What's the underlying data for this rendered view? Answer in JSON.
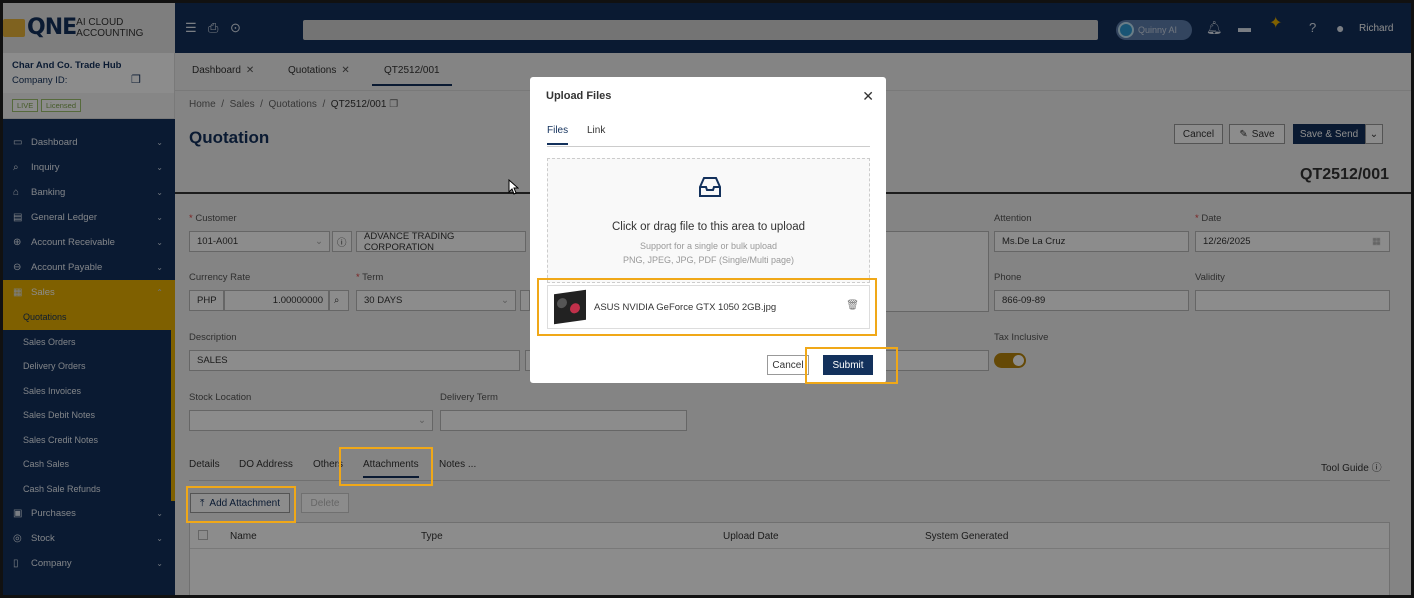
{
  "topbar": {
    "logo_text": "QNE",
    "logo_tagline": "AI CLOUD ACCOUNTING",
    "assistant_label": "Quinny AI",
    "user_name": "Richard"
  },
  "company": {
    "name": "Char And Co. Trade Hub",
    "id_label": "Company ID:",
    "live_badge": "LIVE",
    "licensed_badge": "Licensed"
  },
  "sidebar": {
    "items": [
      {
        "label": "Dashboard",
        "icon": "monitor-icon"
      },
      {
        "label": "Inquiry",
        "icon": "inquiry-icon"
      },
      {
        "label": "Banking",
        "icon": "bank-icon"
      },
      {
        "label": "General Ledger",
        "icon": "ledger-icon"
      },
      {
        "label": "Account Receivable",
        "icon": "receivable-icon"
      },
      {
        "label": "Account Payable",
        "icon": "payable-icon"
      },
      {
        "label": "Sales",
        "icon": "sales-icon"
      }
    ],
    "sales_sub": [
      "Quotations",
      "Sales Orders",
      "Delivery Orders",
      "Sales Invoices",
      "Sales Debit Notes",
      "Sales Credit Notes",
      "Cash Sales",
      "Cash Sale Refunds"
    ],
    "after": [
      {
        "label": "Purchases",
        "icon": "purchases-icon"
      },
      {
        "label": "Stock",
        "icon": "stock-icon"
      },
      {
        "label": "Company",
        "icon": "company-icon"
      }
    ]
  },
  "tabs": [
    "Dashboard",
    "Quotations",
    "QT2512/001"
  ],
  "breadcrumb": {
    "home": "Home",
    "sales": "Sales",
    "quotations": "Quotations",
    "current": "QT2512/001"
  },
  "page": {
    "title": "Quotation",
    "doc_number": "QT2512/001",
    "cancel": "Cancel",
    "save": "Save",
    "save_send": "Save & Send"
  },
  "form": {
    "customer_label": "Customer",
    "customer_code": "101-A001",
    "customer_name": "ADVANCE TRADING CORPORATION",
    "attention_label": "Attention",
    "attention_value": "Ms.De La Cruz",
    "date_label": "Date",
    "date_value": "12/26/2025",
    "currency_label": "Currency Rate",
    "currency_code": "PHP",
    "currency_rate": "1.00000000",
    "term_label": "Term",
    "term_value": "30 DAYS",
    "phone_label": "Phone",
    "phone_value": "866-09-89",
    "validity_label": "Validity",
    "description_label": "Description",
    "description_value": "SALES",
    "tax_label": "Tax Inclusive",
    "stock_location_label": "Stock Location",
    "delivery_term_label": "Delivery Term"
  },
  "subtabs": {
    "details": "Details",
    "do_address": "DO Address",
    "others": "Others",
    "attachments": "Attachments",
    "notes": "Notes ...",
    "tool_guide": "Tool Guide"
  },
  "attachments": {
    "add": "Add Attachment",
    "delete": "Delete",
    "columns": [
      "Name",
      "Type",
      "Upload Date",
      "System Generated"
    ]
  },
  "modal": {
    "title": "Upload Files",
    "tab_files": "Files",
    "tab_link": "Link",
    "drop_title": "Click or drag file to this area to upload",
    "drop_hint1": "Support for a single or bulk upload",
    "drop_hint2": "PNG, JPEG, JPG, PDF (Single/Multi page)",
    "file_name": "ASUS NVIDIA GeForce GTX 1050 2GB.jpg",
    "cancel": "Cancel",
    "submit": "Submit"
  },
  "colors": {
    "navy": "#13315c",
    "accent": "#e8b000",
    "highlight": "#f0a818"
  }
}
